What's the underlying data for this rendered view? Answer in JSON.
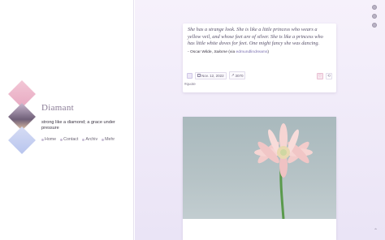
{
  "blog": {
    "title": "Diamant",
    "description": "strong like a diamond; a grace under pressure",
    "nav": [
      {
        "label": "Home",
        "icon": "home-icon"
      },
      {
        "label": "Contact",
        "icon": "mail-icon"
      },
      {
        "label": "Archiv",
        "icon": "archive-icon"
      },
      {
        "label": "Mehr",
        "icon": "more-icon"
      }
    ]
  },
  "post": {
    "quote": "She has a strange look. She is like a little princess who wears a yellow veil, and whose feet are of silver. She is like a princess who has little white doves for feet. One might fancy she was dancing.",
    "source_author": "- Oscar Wilde, ",
    "source_work": "Salome",
    "source_via_prefix": " (via ",
    "source_via": "edmundlindreams",
    "source_via_suffix": ")",
    "date": "Nov. 12, 2022",
    "notes": "3070",
    "tag": "#quote"
  },
  "icons": {
    "rail": [
      "search-icon",
      "dashboard-icon",
      "settings-icon"
    ],
    "back_to_top": "back-to-top-icon"
  },
  "colors": {
    "accent": "#8a7c96",
    "background": "#f1ecf9",
    "like": "#c97a9c"
  }
}
